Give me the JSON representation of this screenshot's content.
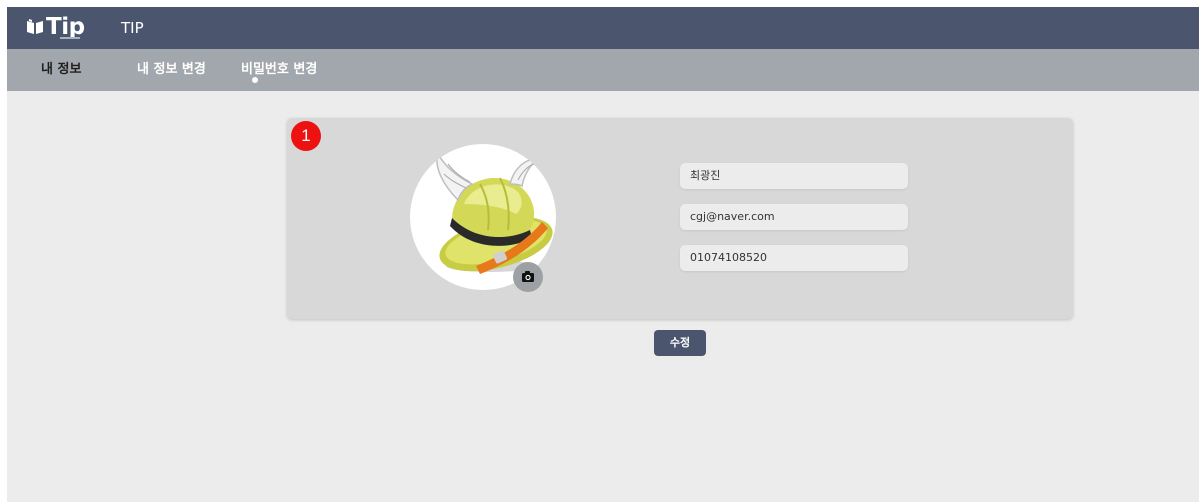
{
  "header": {
    "logo_text": "Tip",
    "app_title": "TIP"
  },
  "nav": {
    "items": [
      {
        "label": "내 정보",
        "active": true
      },
      {
        "label": "내 정보 변경",
        "active": false
      },
      {
        "label": "비밀번호 변경",
        "active": false
      }
    ]
  },
  "profile": {
    "marker_number": "1",
    "name": "최광진",
    "email": "cgj@naver.com",
    "phone": "01074108520",
    "avatar_icon": "winged-helmet-icon",
    "camera_icon": "camera-icon"
  },
  "actions": {
    "edit_label": "수정"
  },
  "colors": {
    "topbar": "#4b566e",
    "subnav": "#a2a7ad",
    "page_bg": "#ebeceb",
    "card_bg": "#d8d8d8",
    "marker": "#ee1111",
    "button": "#4b566e"
  }
}
